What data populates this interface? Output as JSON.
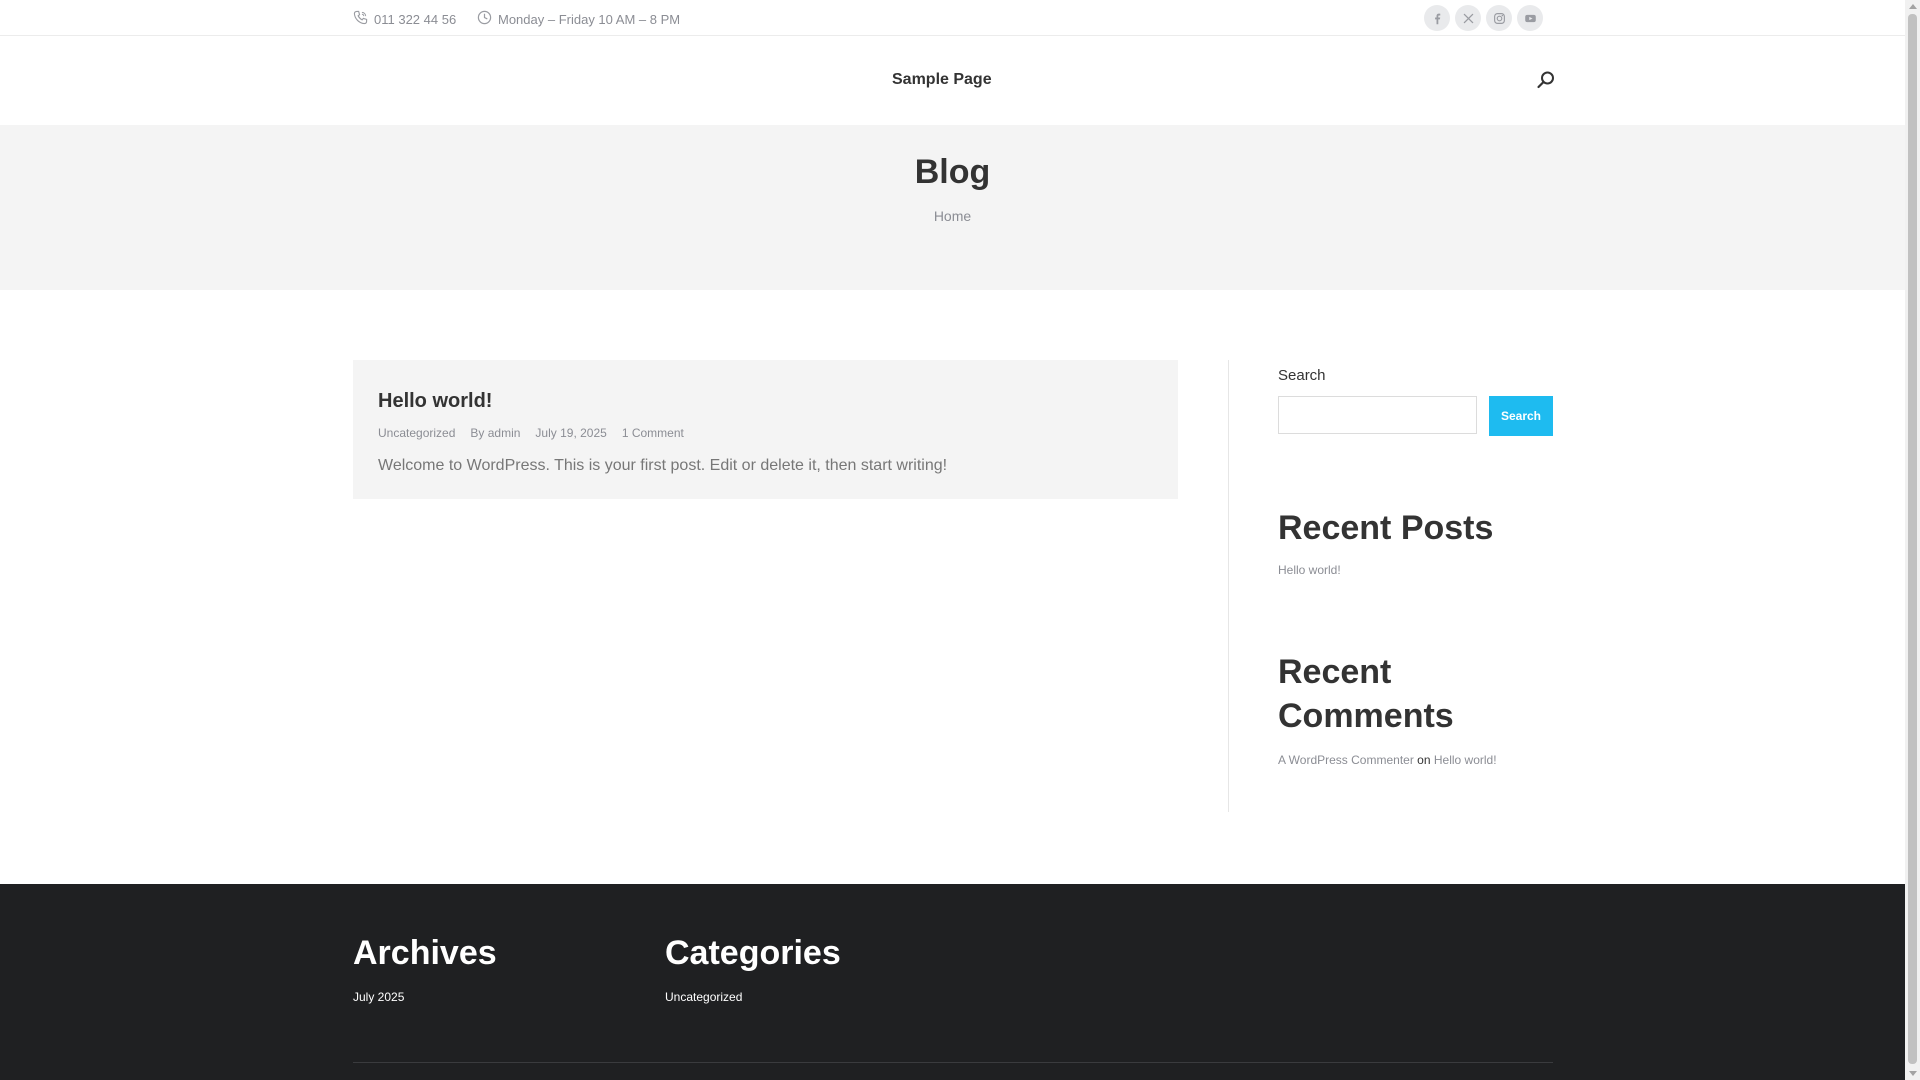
{
  "topbar": {
    "phone": "011 322 44 56",
    "hours": "Monday – Friday 10 AM – 8 PM",
    "social": [
      "facebook-icon",
      "x-twitter-icon",
      "instagram-icon",
      "youtube-icon"
    ]
  },
  "nav": {
    "sample_page": "Sample Page"
  },
  "page_title": {
    "title": "Blog",
    "breadcrumb": "Home"
  },
  "post": {
    "title": "Hello world!",
    "category": "Uncategorized",
    "author": "By admin",
    "date": "July 19, 2025",
    "comments": "1 Comment",
    "excerpt": "Welcome to WordPress. This is your first post. Edit or delete it, then start writing!"
  },
  "sidebar": {
    "search_label": "Search",
    "search_button": "Search",
    "recent_posts_heading": "Recent Posts",
    "recent_posts": [
      "Hello world!"
    ],
    "recent_comments_heading_line1": "Recent",
    "recent_comments_heading_line2": "Comments",
    "comment_author": "A WordPress Commenter",
    "comment_on": "on",
    "comment_post": "Hello world!"
  },
  "footer": {
    "archives_heading": "Archives",
    "archives": [
      "July 2025"
    ],
    "categories_heading": "Categories",
    "categories": [
      "Uncategorized"
    ]
  },
  "colors": {
    "accent": "#1ebbf0",
    "footer_bg": "#1f2022",
    "title_area_bg": "#f4f4f4",
    "muted_text": "#8b8d94"
  }
}
